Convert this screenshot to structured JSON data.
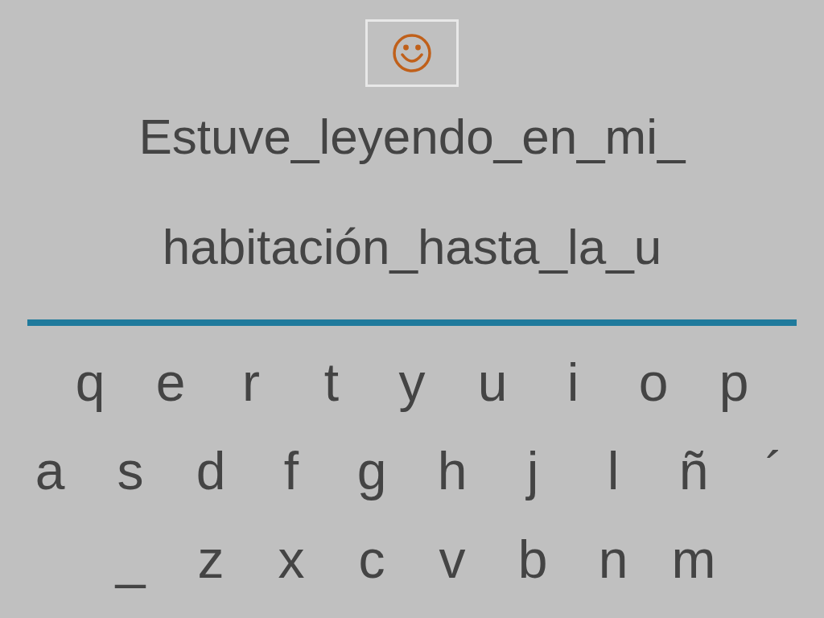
{
  "sentence_lines": [
    "Estuve_leyendo_en_mi_",
    "habitación_hasta_la_u"
  ],
  "keyboard_rows": [
    [
      "q",
      "e",
      "r",
      "t",
      "y",
      "u",
      "i",
      "o",
      "p"
    ],
    [
      "a",
      "s",
      "d",
      "f",
      "g",
      "h",
      "j",
      "l",
      "ñ",
      "´"
    ],
    [
      "_",
      "z",
      "x",
      "c",
      "v",
      "b",
      "n",
      "m"
    ]
  ]
}
